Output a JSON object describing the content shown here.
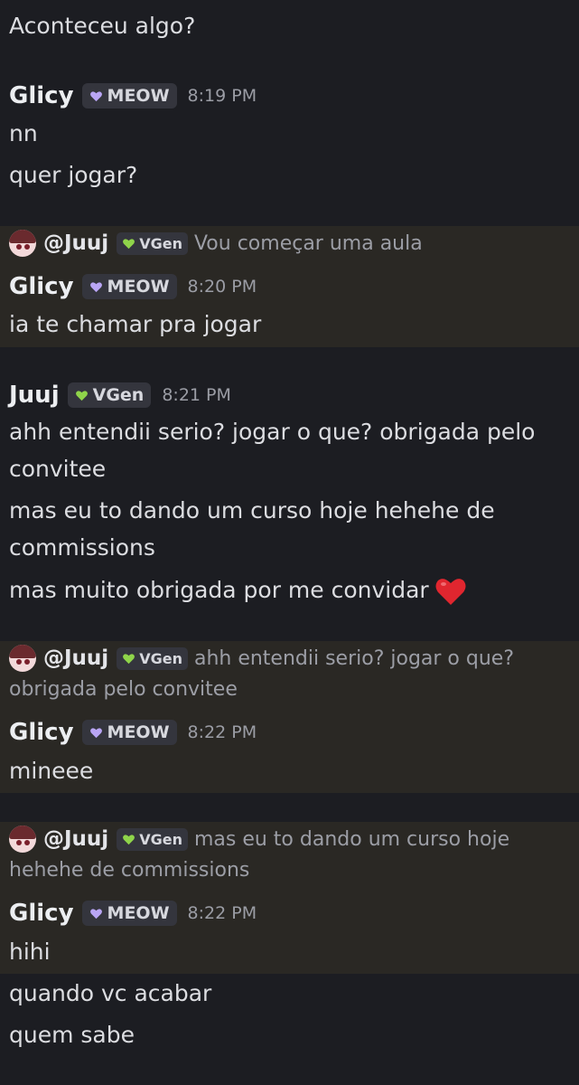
{
  "messages": {
    "top_line": "Aconteceu algo?",
    "m1": {
      "user": "Glicy",
      "tag": "MEOW",
      "time": "8:19 PM",
      "lines": [
        "nn",
        "quer jogar?"
      ]
    },
    "m2": {
      "reply": {
        "user": "@Juuj",
        "tag": "VGen",
        "text": "Vou começar uma aula"
      },
      "user": "Glicy",
      "tag": "MEOW",
      "time": "8:20 PM",
      "lines": [
        "ia te chamar pra jogar"
      ]
    },
    "m3": {
      "user": "Juuj",
      "tag": "VGen",
      "time": "8:21 PM",
      "lines": [
        "ahh entendii serio? jogar o que? obrigada pelo",
        "convitee",
        "mas eu to dando um curso hoje hehehe de",
        "commissions",
        "mas muito obrigada por me convidar"
      ],
      "emoji": "red-heart-icon"
    },
    "m4": {
      "reply": {
        "user": "@Juuj",
        "tag": "VGen",
        "text": "ahh entendii serio? jogar o que?",
        "text2": "obrigada pelo convitee"
      },
      "user": "Glicy",
      "tag": "MEOW",
      "time": "8:22 PM",
      "lines": [
        "mineee"
      ]
    },
    "m5": {
      "reply": {
        "user": "@Juuj",
        "tag": "VGen",
        "text": "mas eu to dando um curso hoje",
        "text2": "hehehe de commissions"
      },
      "user": "Glicy",
      "tag": "MEOW",
      "time": "8:22 PM",
      "lines": [
        "hihi",
        "quando vc acabar",
        "quem sabe"
      ]
    }
  },
  "colors": {
    "background": "#1c1d22",
    "highlight": "#2a2824",
    "meow_heart": "#b9a5f5",
    "vgen_heart": "#8fd44a",
    "red_heart": "#e0262f"
  }
}
